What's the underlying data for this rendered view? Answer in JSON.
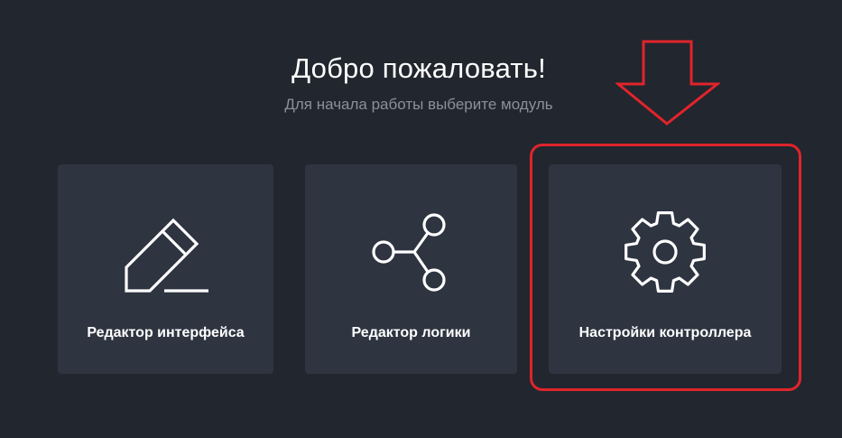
{
  "header": {
    "title": "Добро пожаловать!",
    "subtitle": "Для начала работы выберите модуль"
  },
  "modules": [
    {
      "label": "Редактор интерфейса",
      "icon": "pencil-icon"
    },
    {
      "label": "Редактор логики",
      "icon": "share-nodes-icon"
    },
    {
      "label": "Настройки контроллера",
      "icon": "gear-icon"
    }
  ],
  "annotation": {
    "color": "#e0242b",
    "highlighted_module": "Настройки контроллера"
  },
  "colors": {
    "background": "#22262e",
    "card": "#2e3440",
    "text": "#ffffff",
    "subtitle": "#8b9099"
  }
}
